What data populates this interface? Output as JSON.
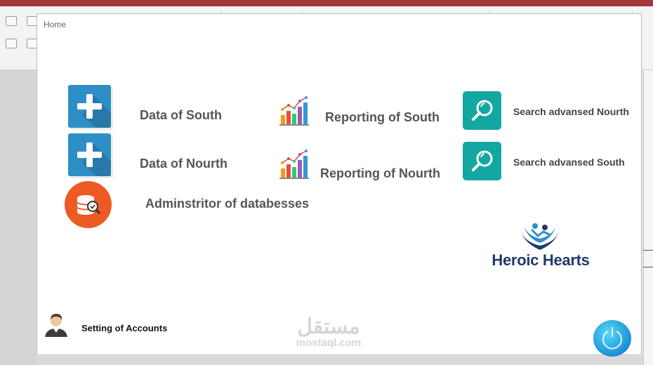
{
  "form": {
    "title": "Home",
    "tiles": {
      "data_south": "Data of South",
      "data_nourth": "Data of Nourth",
      "admin_db": "Adminstritor of databesses",
      "report_south": "Reporting of South",
      "report_nourth": "Reporting of Nourth",
      "search_nourth": "Search advansed Nourth",
      "search_south": "Search advansed South"
    },
    "logo_text": "Heroic Hearts",
    "settings_label": "Setting of Accounts",
    "watermark_ar": "مستقل",
    "watermark_en": "mostaql.com"
  },
  "icons": {
    "plus": "plus-icon",
    "chart": "bar-chart-icon",
    "search": "magnifier-icon",
    "database": "database-icon",
    "user": "user-avatar-icon",
    "power": "power-icon"
  },
  "colors": {
    "plus_tile": "#2e8fc7",
    "search_tile": "#14a7a2",
    "db_tile": "#ee5a24",
    "title_bar": "#a4373a",
    "logo_navy": "#1e3a6e"
  }
}
